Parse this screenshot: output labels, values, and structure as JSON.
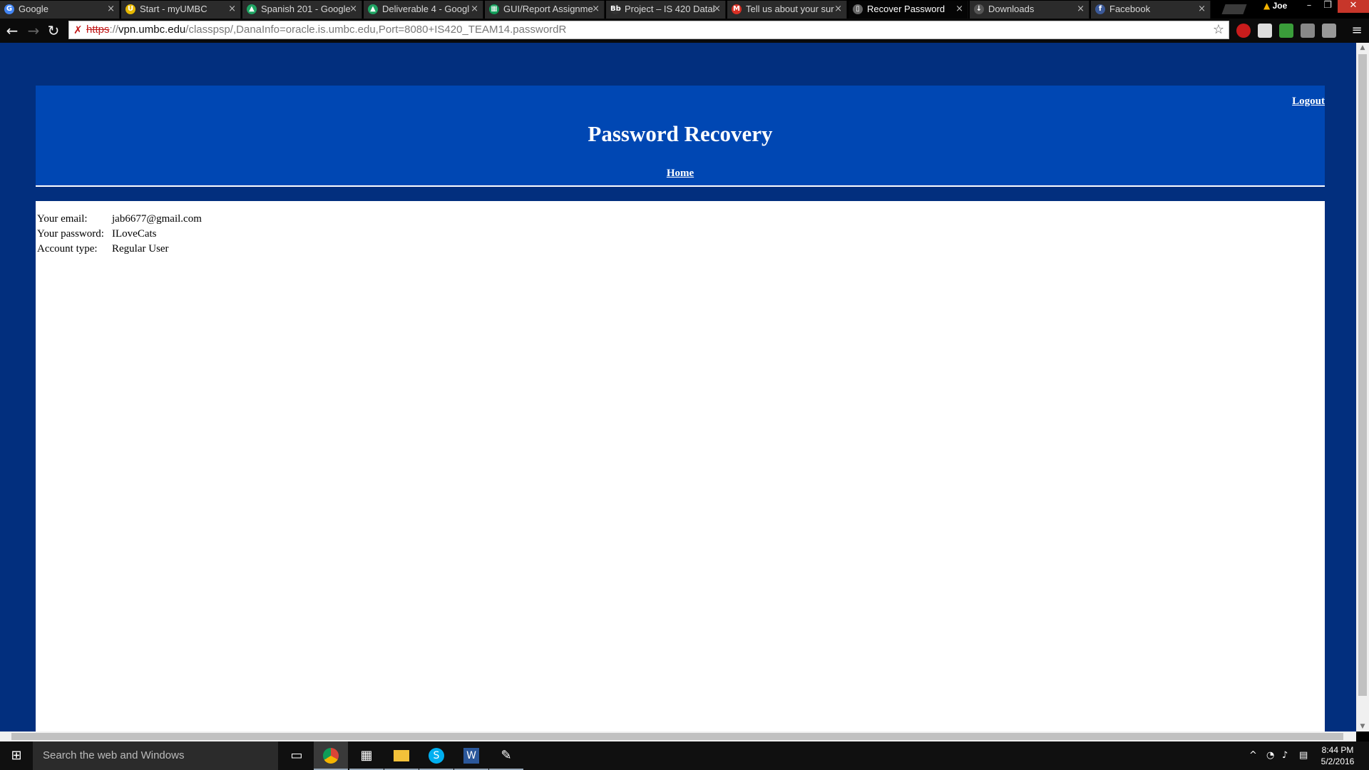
{
  "browser": {
    "tabs": [
      {
        "title": "Google",
        "icon": "google-icon",
        "color": "#4285f4",
        "glyph": "G"
      },
      {
        "title": "Start - myUMBC",
        "icon": "umbc-icon",
        "color": "#e6b800",
        "glyph": "U"
      },
      {
        "title": "Spanish 201 - Google",
        "icon": "google-drive-icon",
        "color": "#1fa463",
        "glyph": "▲"
      },
      {
        "title": "Deliverable 4 - Googl",
        "icon": "google-drive-icon",
        "color": "#1fa463",
        "glyph": "▲"
      },
      {
        "title": "GUI/Report Assignme",
        "icon": "google-sheets-icon",
        "color": "#0f9d58",
        "glyph": "▦"
      },
      {
        "title": "Project – IS 420 Datab",
        "icon": "blackboard-icon",
        "color": "#333333",
        "glyph": "Bb"
      },
      {
        "title": "Tell us about your sur",
        "icon": "gmail-icon",
        "color": "#d93025",
        "glyph": "M"
      },
      {
        "title": "Recover Password",
        "icon": "page-icon",
        "color": "#666666",
        "glyph": "▯",
        "active": true
      },
      {
        "title": "Downloads",
        "icon": "downloads-icon",
        "color": "#555555",
        "glyph": "↓"
      },
      {
        "title": "Facebook",
        "icon": "facebook-icon",
        "color": "#3b5998",
        "glyph": "f"
      }
    ],
    "close_glyph": "×",
    "profile_name": "Joe",
    "url": {
      "scheme": "https",
      "separator": "://",
      "host": "vpn.umbc.edu",
      "path": "/classpsp/,DanaInfo=oracle.is.umbc.edu,Port=8080+IS420_TEAM14.passwordR"
    }
  },
  "page": {
    "logout": "Logout",
    "title": "Password Recovery",
    "home": "Home",
    "rows": [
      {
        "label": "Your email:",
        "value": "jab6677@gmail.com"
      },
      {
        "label": "Your password:",
        "value": "ILoveCats"
      },
      {
        "label": "Account type:",
        "value": "Regular User"
      }
    ]
  },
  "taskbar": {
    "search_placeholder": "Search the web and Windows",
    "time": "8:44 PM",
    "date": "5/2/2016"
  },
  "colors": {
    "page_bg": "#022f7e",
    "header_bg": "#0047b3"
  }
}
